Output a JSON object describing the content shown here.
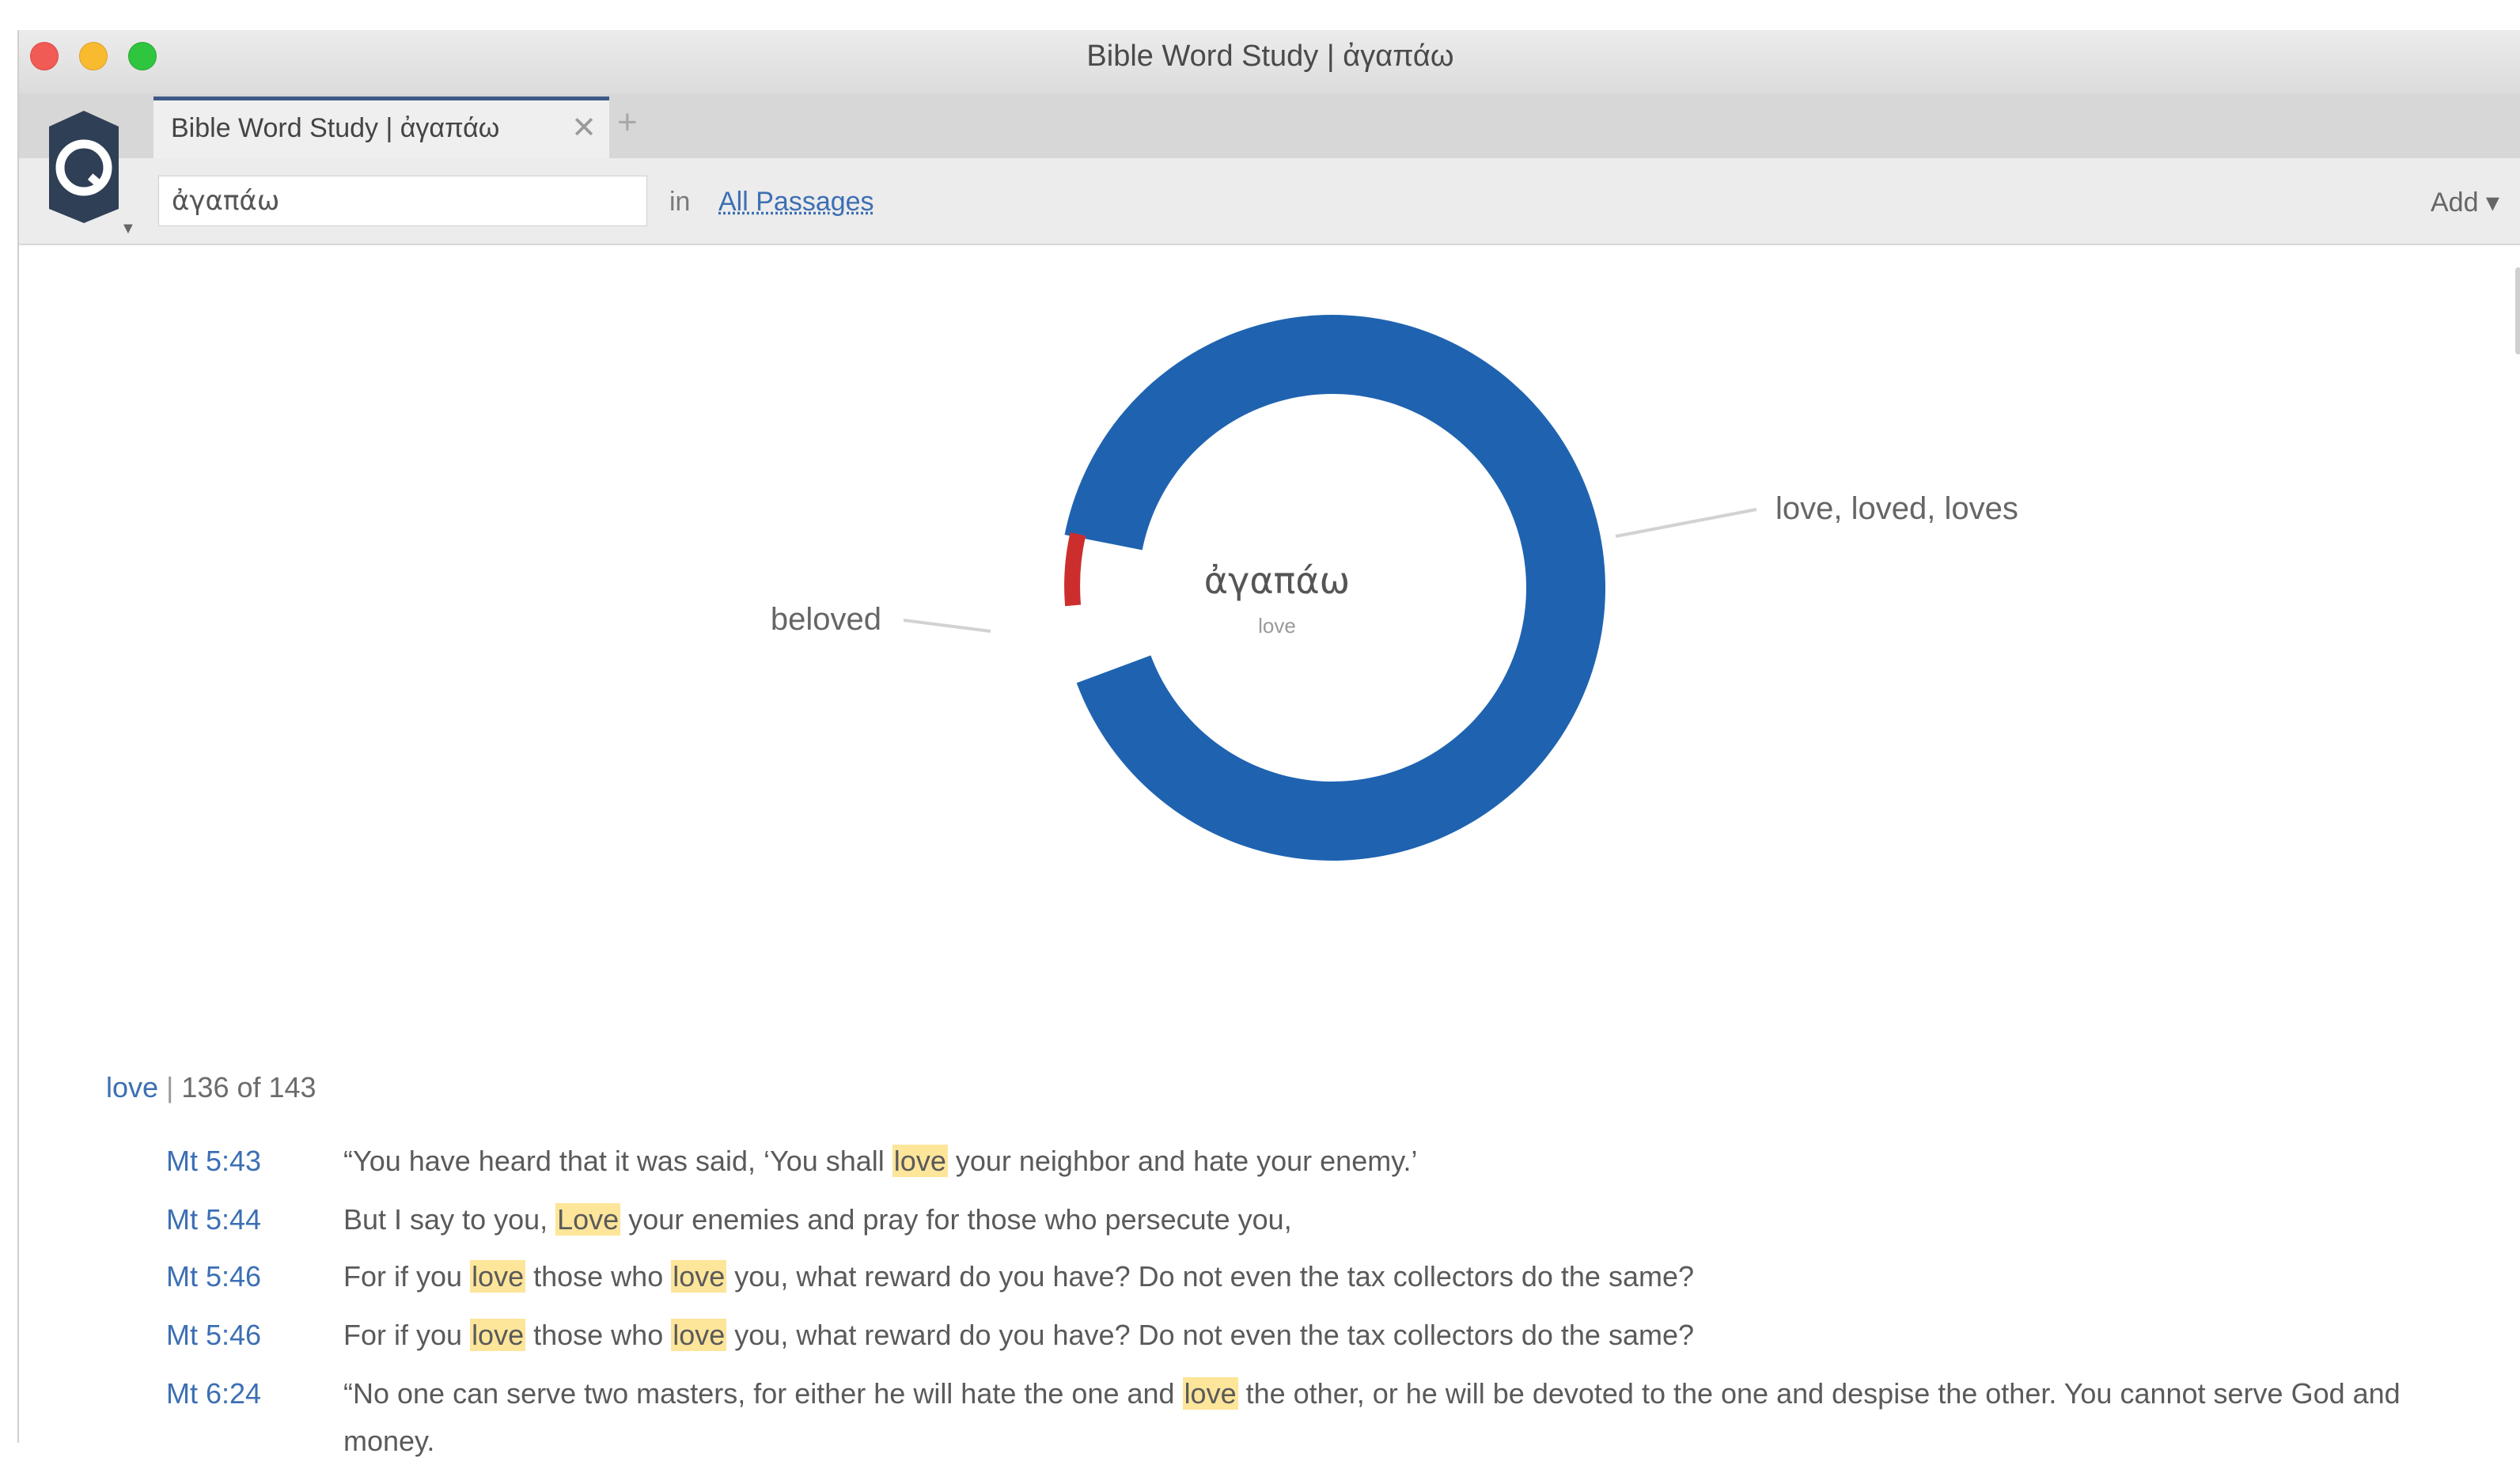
{
  "window": {
    "title": "Bible Word Study | ἀγαπάω"
  },
  "tabs": [
    {
      "label": "Bible Word Study | ἀγαπάω",
      "close": "✕"
    }
  ],
  "new_tab": "+",
  "toolbar": {
    "search_value": "ἀγαπάω",
    "in_label": "in",
    "range_label": "All Passages",
    "add_label": "Add ▾"
  },
  "chart_data": {
    "type": "pie",
    "style": "donut",
    "center_title": "ἀγαπάω",
    "center_subtitle": "love",
    "slices": [
      {
        "label": "love, loved, loves",
        "value": 136,
        "color": "#1f63b0"
      },
      {
        "label": "beloved",
        "value": 7,
        "color": "#cc2e2e"
      }
    ]
  },
  "results": {
    "sense": "love",
    "separator": "|",
    "count_text": "136 of 143",
    "rows": [
      {
        "ref": "Mt 5:43",
        "parts": [
          "“You have heard that it was said, ‘You shall ",
          "love",
          " your neighbor and hate your enemy.’"
        ]
      },
      {
        "ref": "Mt 5:44",
        "parts": [
          "But I say to you, ",
          "Love",
          " your enemies and pray for those who persecute you,"
        ]
      },
      {
        "ref": "Mt 5:46",
        "parts": [
          "For if you ",
          "love",
          " those who ",
          "love",
          " you, what reward do you have? Do not even the tax collectors do the same?"
        ]
      },
      {
        "ref": "Mt 5:46",
        "parts": [
          "For if you ",
          "love",
          " those who ",
          "love",
          " you, what reward do you have? Do not even the tax collectors do the same?"
        ]
      },
      {
        "ref": "Mt 6:24",
        "parts": [
          "“No one can serve two masters, for either he will hate the one and ",
          "love",
          " the other, or he will be devoted to the one and despise the other. You cannot serve God and money."
        ]
      }
    ]
  }
}
